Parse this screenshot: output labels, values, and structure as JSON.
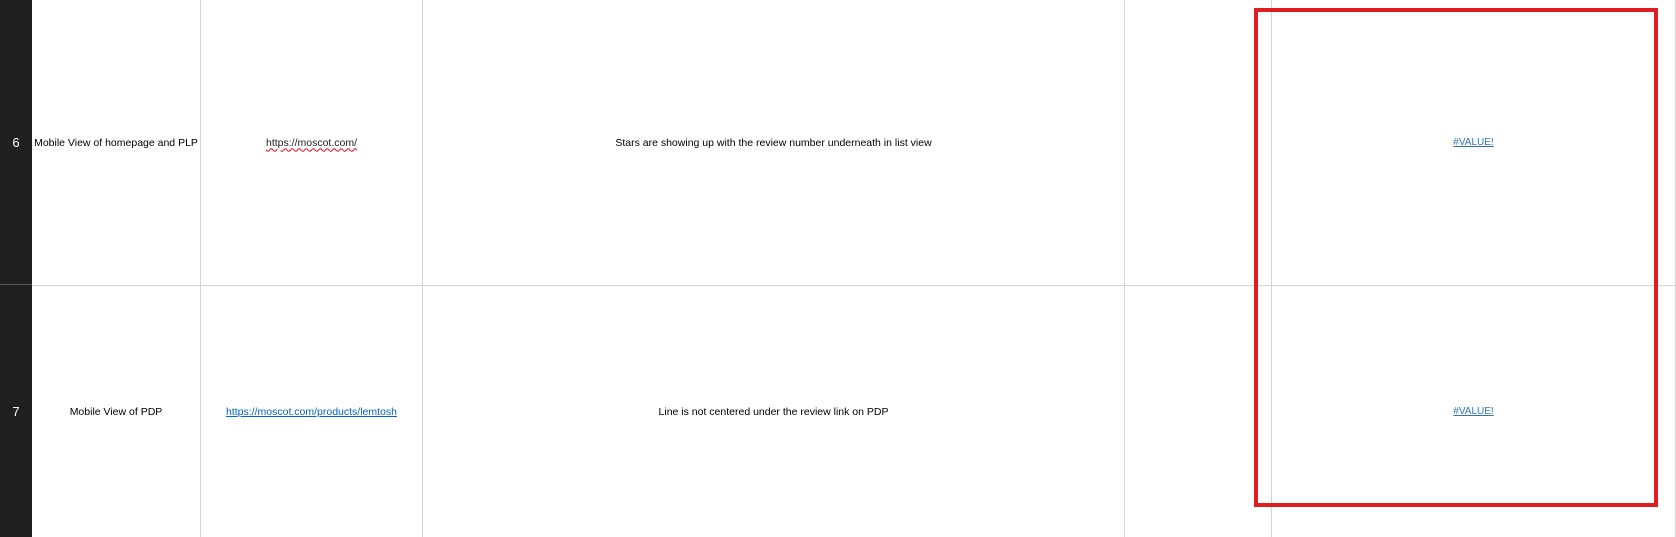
{
  "rows": [
    {
      "number": "6",
      "col_a": "Mobile View of homepage and PLP",
      "col_b": "https://moscot.com/",
      "col_c": "Stars are showing up with the review number underneath in list view",
      "col_d": "",
      "col_e": "#VALUE!"
    },
    {
      "number": "7",
      "col_a": "Mobile View of PDP",
      "col_b": "https://moscot.com/products/lemtosh",
      "col_c": "Line is not centered under the review link on PDP",
      "col_d": "",
      "col_e": "#VALUE!"
    }
  ],
  "colors": {
    "row_header_bg": "#1f1f1f",
    "gridline": "#d4d4d4",
    "link": "#0563c1",
    "selection_border": "#e11d24"
  }
}
